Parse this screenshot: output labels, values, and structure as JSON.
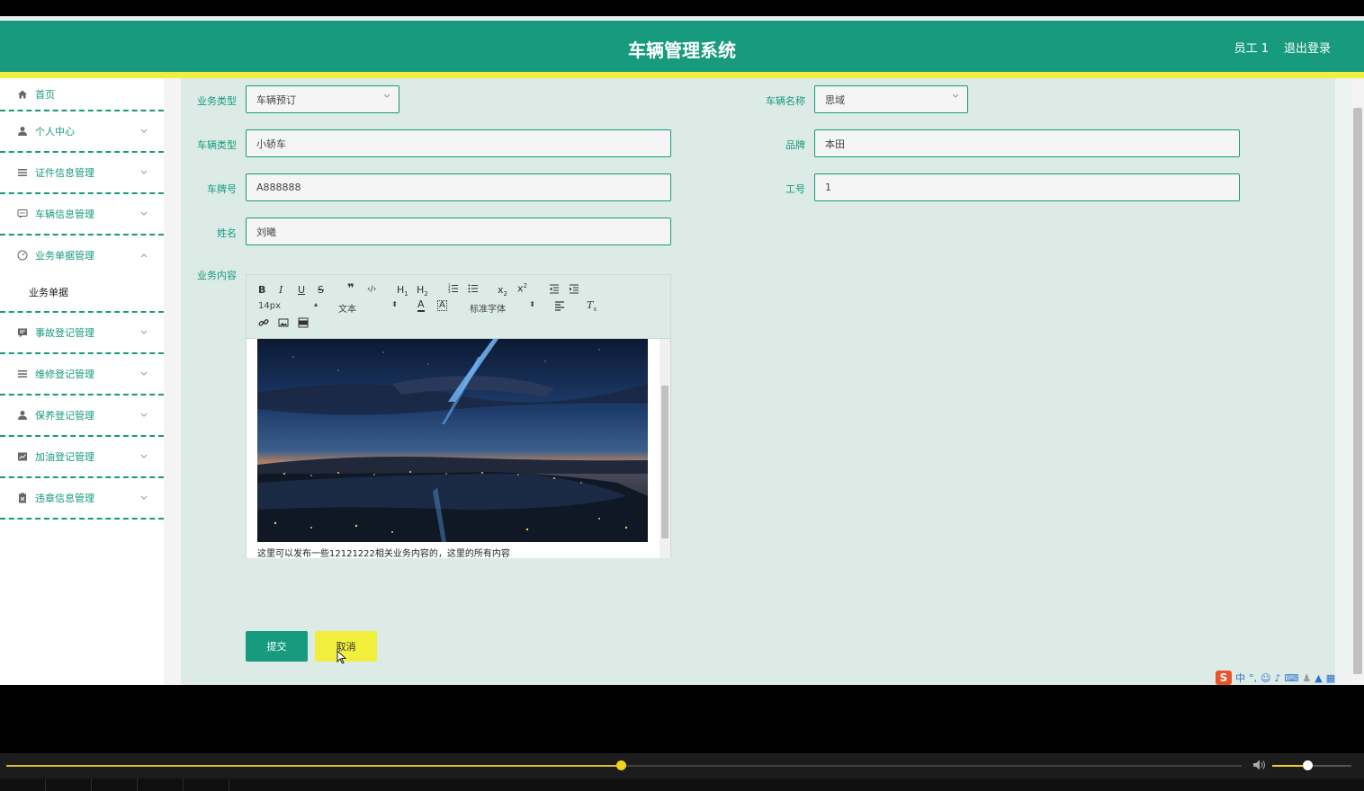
{
  "header": {
    "title": "车辆管理系统",
    "user": "员工 1",
    "logout": "退出登录"
  },
  "sidebar": {
    "items": [
      {
        "label": "首页",
        "icon": "home-icon"
      },
      {
        "label": "个人中心",
        "icon": "user-icon"
      },
      {
        "label": "证件信息管理",
        "icon": "list-icon"
      },
      {
        "label": "车辆信息管理",
        "icon": "chat-icon"
      },
      {
        "label": "业务单据管理",
        "icon": "gauge-icon"
      },
      {
        "label": "事故登记管理",
        "icon": "comment-icon"
      },
      {
        "label": "维修登记管理",
        "icon": "list-icon"
      },
      {
        "label": "保养登记管理",
        "icon": "user-icon"
      },
      {
        "label": "加油登记管理",
        "icon": "chart-icon"
      },
      {
        "label": "违章信息管理",
        "icon": "clipboard-icon"
      }
    ],
    "sub_item": "业务单据"
  },
  "form": {
    "business_type": {
      "label": "业务类型",
      "value": "车辆预订"
    },
    "vehicle_name": {
      "label": "车辆名称",
      "value": "思域"
    },
    "vehicle_type": {
      "label": "车辆类型",
      "value": "小轿车"
    },
    "brand": {
      "label": "品牌",
      "value": "本田"
    },
    "plate": {
      "label": "车牌号",
      "value": "A888888"
    },
    "employee_no": {
      "label": "工号",
      "value": "1"
    },
    "name": {
      "label": "姓名",
      "value": "刘曦"
    },
    "content": {
      "label": "业务内容",
      "text": "这里可以发布一些12121222相关业务内容的，这里的所有内容"
    }
  },
  "editor": {
    "font_size": "14px",
    "text_type": "文本",
    "font_family": "标准字体"
  },
  "buttons": {
    "submit": "提交",
    "cancel": "取消"
  },
  "ime": {
    "mode": "中"
  },
  "player": {
    "progress": 0.497,
    "volume": 0.44
  },
  "colors": {
    "primary": "#179a7e",
    "accent": "#f2ef3c",
    "main_bg": "#dcebe6"
  }
}
